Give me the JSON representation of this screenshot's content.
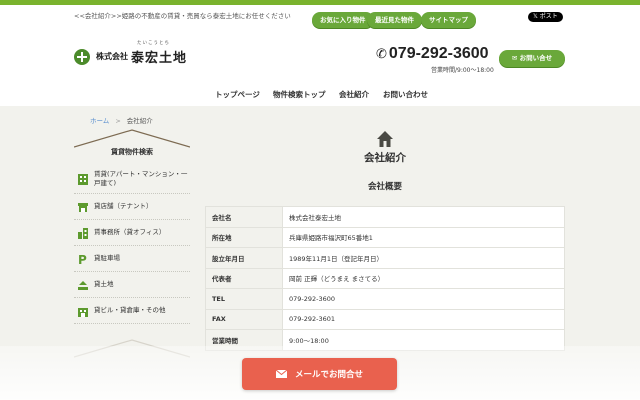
{
  "header": {
    "tagline": "<<会社紹介>>姫路の不動産の賃貸・売買なら泰宏土地にお任せください",
    "top_links": [
      "お気に入り物件",
      "最近見た物件",
      "サイトマップ"
    ],
    "x_post": "𝕏 ポスト",
    "logo_sub": "株式会社",
    "logo_main": "泰宏土地",
    "logo_ruby": "たいこうとち",
    "phone": "079-292-3600",
    "hours": "営業時間/9:00～18:00",
    "contact_button": "お問い合せ"
  },
  "nav": {
    "items": [
      "トップページ",
      "物件検索トップ",
      "会社紹介",
      "お問い合わせ"
    ]
  },
  "breadcrumb": {
    "home": "ホーム",
    "separator": ">",
    "current": "会社紹介"
  },
  "sidebar": {
    "title": "賃貸物件検索",
    "items": [
      {
        "label": "賃貸(アパート・マンション・一戸建て)",
        "icon": "building-icon"
      },
      {
        "label": "貸店舗（テナント）",
        "icon": "store-icon"
      },
      {
        "label": "賃事務所（貸オフィス）",
        "icon": "office-icon"
      },
      {
        "label": "貸駐車場",
        "icon": "parking-icon"
      },
      {
        "label": "貸土地",
        "icon": "land-icon"
      },
      {
        "label": "貸ビル・貸倉庫・その他",
        "icon": "warehouse-icon"
      }
    ]
  },
  "main": {
    "page_title": "会社紹介",
    "section_title": "会社概要",
    "rows": [
      {
        "key": "会社名",
        "value": "株式会社泰宏土地"
      },
      {
        "key": "所在地",
        "value": "兵庫県姫路市福沢町65番地1"
      },
      {
        "key": "設立年月日",
        "value": "1989年11月1日（登記年月日）"
      },
      {
        "key": "代表者",
        "value": "岡前 正輝（どうまえ まさてる）"
      },
      {
        "key": "TEL",
        "value": "079-292-3600"
      },
      {
        "key": "FAX",
        "value": "079-292-3601"
      },
      {
        "key": "営業時間",
        "value": "9:00～18:00"
      }
    ]
  },
  "mail_button": "メールでお問合せ",
  "colors": {
    "accent_green": "#6aa83a",
    "mail_button": "#e9614e",
    "link_blue": "#5a8fcf"
  }
}
